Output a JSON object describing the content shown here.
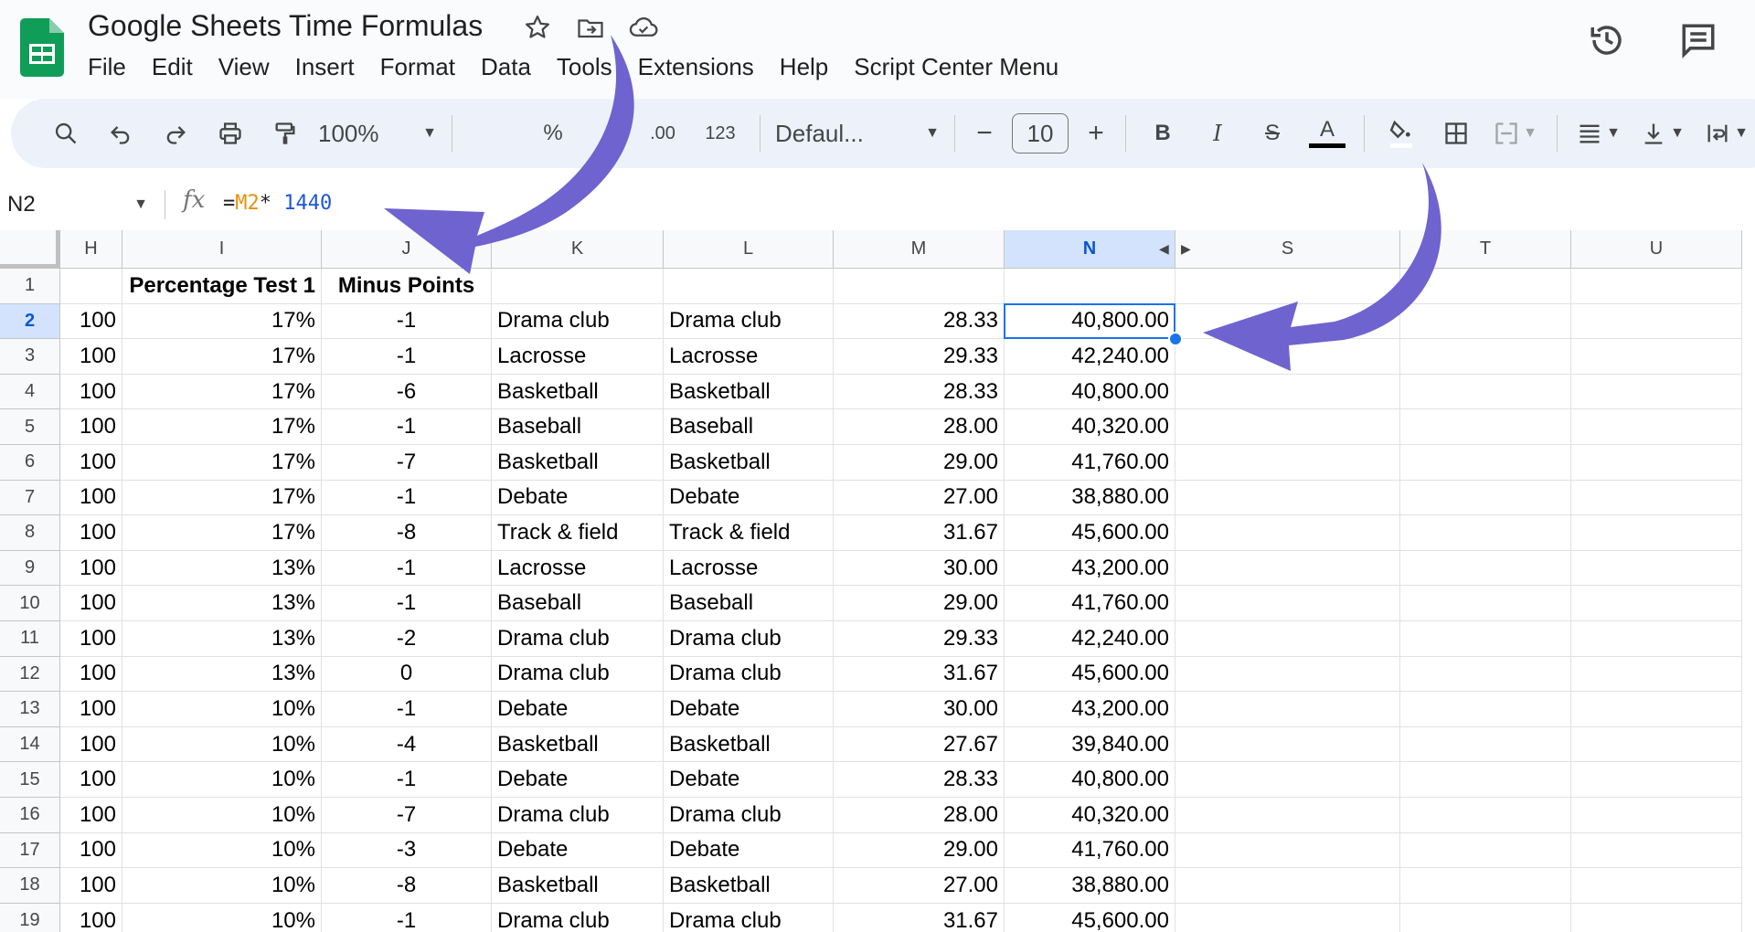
{
  "app": {
    "title": "Google Sheets Time Formulas",
    "menu": [
      "File",
      "Edit",
      "View",
      "Insert",
      "Format",
      "Data",
      "Tools",
      "Extensions",
      "Help",
      "Script Center Menu"
    ]
  },
  "toolbar": {
    "zoom": "100%",
    "percent": "%",
    "decimal_decrease": ".0",
    "decimal_increase": ".00",
    "number_format": "123",
    "font_name": "Defaul...",
    "minus": "−",
    "font_size": "10",
    "plus": "+",
    "bold": "B",
    "italic": "I",
    "strike": "S",
    "text_color": "A"
  },
  "formula_bar": {
    "name_box": "N2",
    "fx": "fx",
    "formula_eq": "=",
    "formula_ref": "M2",
    "formula_op": "* ",
    "formula_num": "1440"
  },
  "columns": [
    "H",
    "I",
    "J",
    "K",
    "L",
    "M",
    "N",
    "S",
    "T",
    "U"
  ],
  "selected_column": "N",
  "selected_row": 2,
  "rows": [
    {
      "num": "1",
      "H": "",
      "I": "Percentage Test 1",
      "J": "Minus Points",
      "K": "",
      "L": "",
      "M": "",
      "N": ""
    },
    {
      "num": "2",
      "H": "100",
      "I": "17%",
      "J": "-1",
      "K": "Drama club",
      "L": "Drama club",
      "M": "28.33",
      "N": "40,800.00"
    },
    {
      "num": "3",
      "H": "100",
      "I": "17%",
      "J": "-1",
      "K": "Lacrosse",
      "L": "Lacrosse",
      "M": "29.33",
      "N": "42,240.00"
    },
    {
      "num": "4",
      "H": "100",
      "I": "17%",
      "J": "-6",
      "K": "Basketball",
      "L": "Basketball",
      "M": "28.33",
      "N": "40,800.00"
    },
    {
      "num": "5",
      "H": "100",
      "I": "17%",
      "J": "-1",
      "K": "Baseball",
      "L": "Baseball",
      "M": "28.00",
      "N": "40,320.00"
    },
    {
      "num": "6",
      "H": "100",
      "I": "17%",
      "J": "-7",
      "K": "Basketball",
      "L": "Basketball",
      "M": "29.00",
      "N": "41,760.00"
    },
    {
      "num": "7",
      "H": "100",
      "I": "17%",
      "J": "-1",
      "K": "Debate",
      "L": "Debate",
      "M": "27.00",
      "N": "38,880.00"
    },
    {
      "num": "8",
      "H": "100",
      "I": "17%",
      "J": "-8",
      "K": "Track & field",
      "L": "Track & field",
      "M": "31.67",
      "N": "45,600.00"
    },
    {
      "num": "9",
      "H": "100",
      "I": "13%",
      "J": "-1",
      "K": "Lacrosse",
      "L": "Lacrosse",
      "M": "30.00",
      "N": "43,200.00"
    },
    {
      "num": "10",
      "H": "100",
      "I": "13%",
      "J": "-1",
      "K": "Baseball",
      "L": "Baseball",
      "M": "29.00",
      "N": "41,760.00"
    },
    {
      "num": "11",
      "H": "100",
      "I": "13%",
      "J": "-2",
      "K": "Drama club",
      "L": "Drama club",
      "M": "29.33",
      "N": "42,240.00"
    },
    {
      "num": "12",
      "H": "100",
      "I": "13%",
      "J": "0",
      "K": "Drama club",
      "L": "Drama club",
      "M": "31.67",
      "N": "45,600.00"
    },
    {
      "num": "13",
      "H": "100",
      "I": "10%",
      "J": "-1",
      "K": "Debate",
      "L": "Debate",
      "M": "30.00",
      "N": "43,200.00"
    },
    {
      "num": "14",
      "H": "100",
      "I": "10%",
      "J": "-4",
      "K": "Basketball",
      "L": "Basketball",
      "M": "27.67",
      "N": "39,840.00"
    },
    {
      "num": "15",
      "H": "100",
      "I": "10%",
      "J": "-1",
      "K": "Debate",
      "L": "Debate",
      "M": "28.33",
      "N": "40,800.00"
    },
    {
      "num": "16",
      "H": "100",
      "I": "10%",
      "J": "-7",
      "K": "Drama club",
      "L": "Drama club",
      "M": "28.00",
      "N": "40,320.00"
    },
    {
      "num": "17",
      "H": "100",
      "I": "10%",
      "J": "-3",
      "K": "Debate",
      "L": "Debate",
      "M": "29.00",
      "N": "41,760.00"
    },
    {
      "num": "18",
      "H": "100",
      "I": "10%",
      "J": "-8",
      "K": "Basketball",
      "L": "Basketball",
      "M": "27.00",
      "N": "38,880.00"
    },
    {
      "num": "19",
      "H": "100",
      "I": "10%",
      "J": "-1",
      "K": "Drama club",
      "L": "Drama club",
      "M": "31.67",
      "N": "45,600.00"
    }
  ],
  "colors": {
    "accent": "#1a73e8",
    "annotation_arrow": "#6f63cf",
    "sheets_green": "#0f9d58"
  }
}
